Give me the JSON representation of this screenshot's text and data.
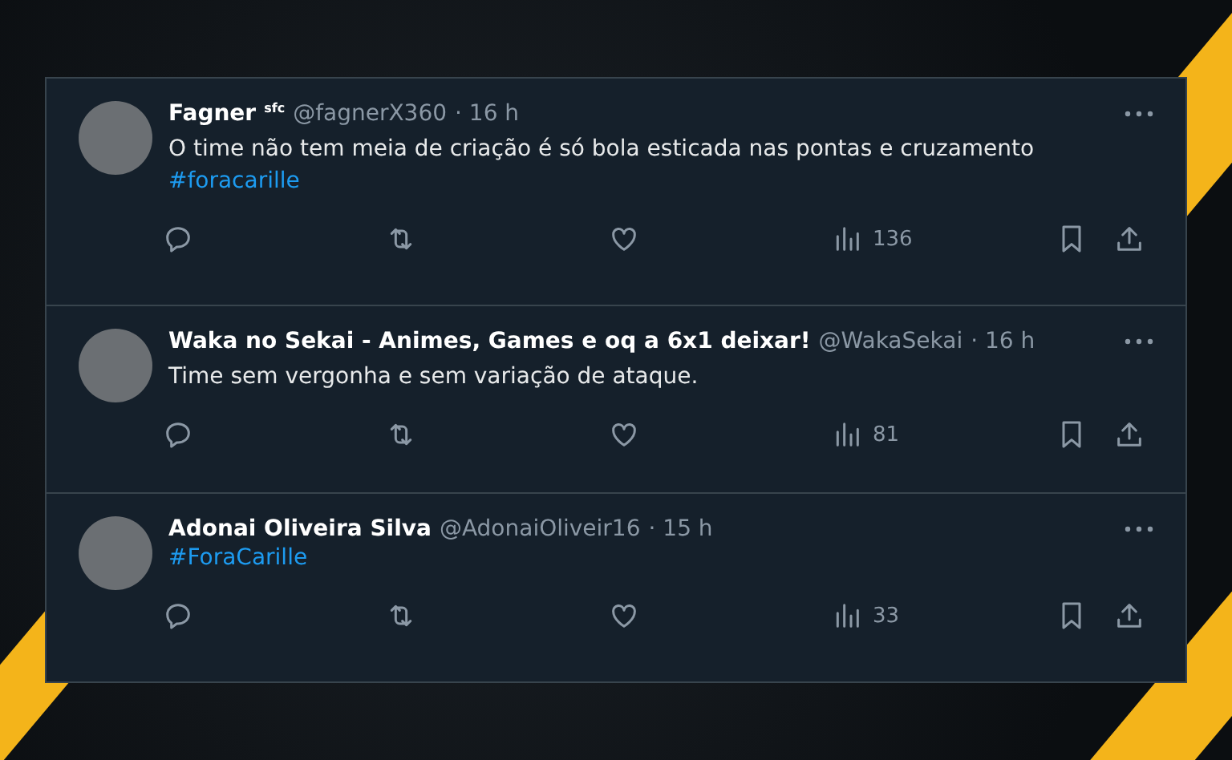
{
  "tweets": [
    {
      "name": "Fagner",
      "badge": "sfc",
      "handle": "@fagnerX360",
      "time": "· 16 h",
      "text": "O time não tem meia de criação é só bola esticada nas pontas e cruzamento",
      "hashtag": "#foracarille",
      "views": "136"
    },
    {
      "name": "Waka no Sekai - Animes, Games e oq a 6x1 deixar!",
      "handle": "@WakaSekai",
      "time": "· 16 h",
      "text": "Time sem vergonha e sem variação de ataque.",
      "views": "81"
    },
    {
      "name": "Adonai Oliveira Silva",
      "handle": "@AdonaiOliveir16",
      "time": "· 15 h",
      "hashtag": "#ForaCarille",
      "views": "33"
    }
  ]
}
